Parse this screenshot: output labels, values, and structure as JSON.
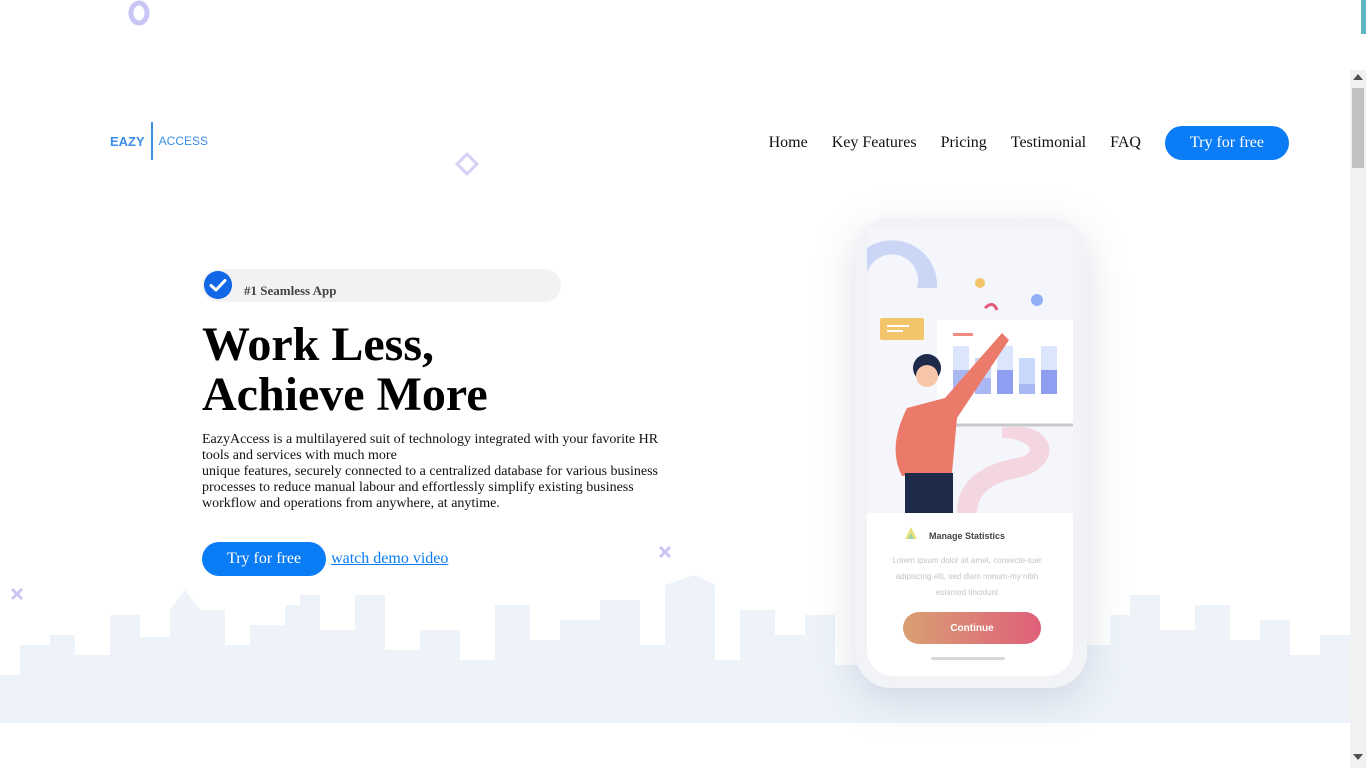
{
  "logo": {
    "part1": "EAZY",
    "part2": "ACCESS"
  },
  "nav": {
    "items": [
      {
        "label": "Home"
      },
      {
        "label": "Key Features"
      },
      {
        "label": "Pricing"
      },
      {
        "label": "Testimonial"
      },
      {
        "label": "FAQ"
      }
    ],
    "cta_label": "Try for free"
  },
  "hero": {
    "badge": "#1 Seamless App",
    "title_line1": "Work Less,",
    "title_line2": "Achieve More",
    "desc_line1": "EazyAccess is a multilayered suit of technology integrated with your favorite HR tools and services with much more",
    "desc_line2": "unique features, securely connected to a centralized database for various business processes to reduce manual labour and effortlessly simplify existing business workflow and operations from anywhere, at anytime.",
    "cta_label": "Try for free",
    "demo_label": "watch demo video"
  },
  "phone": {
    "card_title": "Manage Statistics",
    "card_body": "Lorem ipsum dolor sit amet, consecte-tuer adipiscing elit, sed diam nonum-my nibh euismod tincidunt",
    "card_button": "Continue"
  },
  "colors": {
    "accent": "#0a7cf5",
    "logo": "#3a8ee6",
    "skyline": "#eef3fa",
    "decor": "#c9c6f5"
  }
}
